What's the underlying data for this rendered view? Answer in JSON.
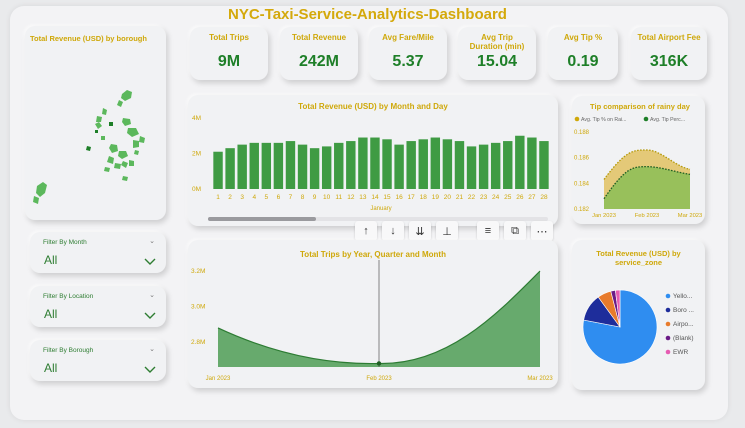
{
  "dashboard": {
    "title": "NYC-Taxi-Service-Analytics-Dashboard"
  },
  "map": {
    "title": "Total Revenue (USD) by borough"
  },
  "kpis": [
    {
      "label": "Total Trips",
      "value": "9M"
    },
    {
      "label": "Total Revenue",
      "value": "242M"
    },
    {
      "label": "Avg Fare/Mile",
      "value": "5.37"
    },
    {
      "label": "Avg Trip Duration (min)",
      "value": "15.04"
    },
    {
      "label": "Avg Tip %",
      "value": "0.19"
    },
    {
      "label": "Total Airport Fee",
      "value": "316K"
    }
  ],
  "filters": [
    {
      "label": "Filter By Month",
      "value": "All"
    },
    {
      "label": "Filter By Location",
      "value": "All"
    },
    {
      "label": "Filter By Borough",
      "value": "All"
    }
  ],
  "toolbar": {
    "icons": [
      "arrow-up-icon",
      "arrow-down-icon",
      "double-arrow-down-icon",
      "fork-icon",
      "filter-icon",
      "focus-mode-icon",
      "more-options-icon"
    ]
  },
  "colors": {
    "accent": "#cfa80a",
    "bar": "#3f9b43",
    "dark_green": "#1e7f28",
    "title": "#d4a90c"
  },
  "chart_data": [
    {
      "type": "bar",
      "title": "Total Revenue (USD) by Month and Day",
      "xlabel": "January",
      "ylabel": "",
      "categories": [
        "1",
        "2",
        "3",
        "4",
        "5",
        "6",
        "7",
        "8",
        "9",
        "10",
        "11",
        "12",
        "13",
        "14",
        "15",
        "16",
        "17",
        "18",
        "19",
        "20",
        "21",
        "22",
        "23",
        "24",
        "25",
        "26",
        "27",
        "28"
      ],
      "values": [
        2.1,
        2.3,
        2.5,
        2.6,
        2.6,
        2.6,
        2.7,
        2.5,
        2.3,
        2.4,
        2.6,
        2.7,
        2.9,
        2.9,
        2.8,
        2.5,
        2.7,
        2.8,
        2.9,
        2.8,
        2.7,
        2.4,
        2.5,
        2.6,
        2.7,
        3.0,
        2.9,
        2.7
      ],
      "unit": "M",
      "yticks": [
        "0M",
        "2M",
        "4M"
      ],
      "ylim": [
        0,
        4
      ]
    },
    {
      "type": "area",
      "title": "Tip comparison of rainy day",
      "categories": [
        "Jan 2023",
        "Feb 2023",
        "Mar 2023"
      ],
      "series": [
        {
          "name": "Avg. Tip % on Rai...",
          "values": [
            0.1843,
            0.1866,
            0.1851
          ],
          "color": "#e2c46a"
        },
        {
          "name": "Avg. Tip Perc...",
          "values": [
            0.1828,
            0.1853,
            0.1847
          ],
          "color": "#8fbf58"
        }
      ],
      "yticks": [
        "0.188",
        "0.186",
        "0.184",
        "0.182"
      ],
      "ylim": [
        0.182,
        0.188
      ]
    },
    {
      "type": "area",
      "title": "Total Trips by Year, Quarter and Month",
      "categories": [
        "Jan 2023",
        "Feb 2023",
        "Mar 2023"
      ],
      "x": [
        0,
        0.5,
        1.0
      ],
      "values": [
        2.88,
        2.68,
        3.2
      ],
      "unit": "M",
      "yticks": [
        "3.2M",
        "3.0M",
        "2.8M"
      ],
      "ylim": [
        2.66,
        3.24
      ],
      "highlight_category": "Feb 2023"
    },
    {
      "type": "pie",
      "title": "Total Revenue (USD) by service_zone",
      "labels": [
        "Yello...",
        "Boro ...",
        "Airpo...",
        "(Blank)",
        "EWR"
      ],
      "values": [
        78,
        12,
        6,
        2,
        2
      ],
      "colors": [
        "#2f8df0",
        "#1e2d9b",
        "#e87b2c",
        "#6b1a86",
        "#e65cb2"
      ]
    }
  ]
}
